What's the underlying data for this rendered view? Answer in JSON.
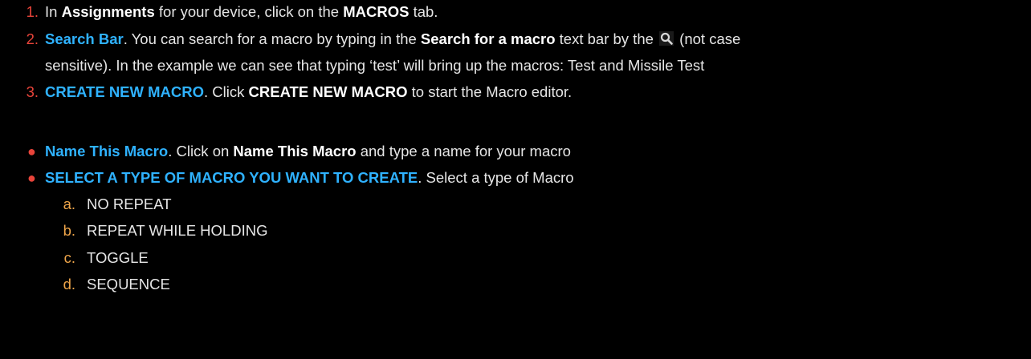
{
  "steps": [
    {
      "marker": "1.",
      "pre": "In ",
      "b1": "Assignments",
      "mid": " for your device, click on the ",
      "b2": "MACROS",
      "post": " tab."
    },
    {
      "marker": "2.",
      "hl": "Search Bar",
      "a": ". You can search for a macro by typing in the ",
      "b1": "Search for a macro",
      "b": " text bar by the ",
      "icon": "search-icon",
      "c": " (not case",
      "line2": "sensitive).  In the example we can see that typing ‘test’ will bring up the macros: Test and Missile Test"
    },
    {
      "marker": "3.",
      "hl": "CREATE NEW MACRO",
      "a": ". Click ",
      "b1": "CREATE NEW MACRO",
      "b": " to start the Macro editor."
    }
  ],
  "bullets": [
    {
      "marker": "●",
      "hl": "Name This Macro",
      "a": ".  Click on ",
      "b1": "Name This Macro",
      "b": " and type a name for your macro"
    },
    {
      "marker": "●",
      "hl": "SELECT A TYPE OF MACRO YOU WANT TO CREATE",
      "a": ".  Select a type of Macro"
    }
  ],
  "subitems": [
    {
      "marker": "a.",
      "text": "NO REPEAT"
    },
    {
      "marker": "b.",
      "text": "REPEAT WHILE HOLDING"
    },
    {
      "marker": "c.",
      "text": "TOGGLE"
    },
    {
      "marker": "d.",
      "text": "SEQUENCE"
    }
  ],
  "colors": {
    "background": "#000000",
    "text": "#e6e6e6",
    "number_marker": "#e8443a",
    "alpha_marker": "#f0a64a",
    "highlight": "#2fb2ff"
  }
}
